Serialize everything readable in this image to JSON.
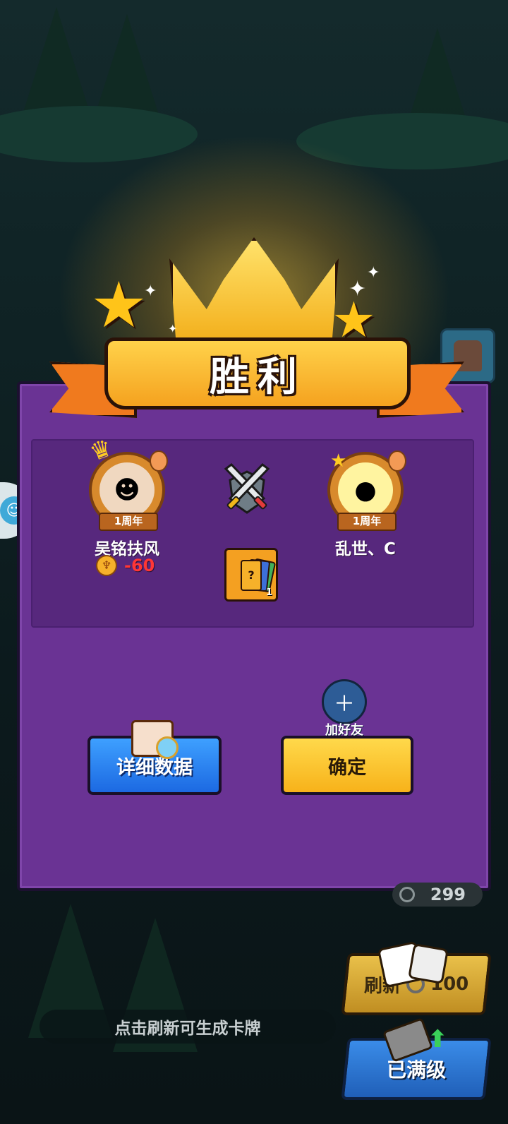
{
  "result": {
    "title": "胜利"
  },
  "players": {
    "left": {
      "name": "吴铭扶风",
      "badge": "1周年",
      "trophy_change": "-60"
    },
    "right": {
      "name": "乱世、C",
      "badge": "1周年"
    }
  },
  "reward": {
    "card_count": "1"
  },
  "actions": {
    "add_friend": "加好友",
    "detail_button": "详细数据",
    "confirm_button": "确定"
  },
  "hud": {
    "coins": "299",
    "refresh_label": "刷新",
    "refresh_cost": "100",
    "hint": "点击刷新可生成卡牌",
    "upgrade_label": "已满级"
  },
  "colors": {
    "panel": "#6a3394",
    "ribbon": "#f5a21f",
    "confirm": "#f7b21a",
    "detail": "#1c69e2",
    "trophy_loss": "#ff3636"
  }
}
